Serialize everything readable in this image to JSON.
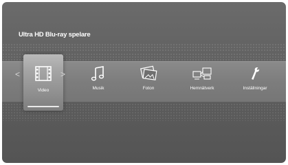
{
  "header": {
    "title": "Ultra HD Blu-ray spelare"
  },
  "menu": {
    "prev_arrow": "<",
    "next_arrow": ">",
    "items": [
      {
        "label": "Video",
        "icon": "film-icon",
        "selected": true
      },
      {
        "label": "Musik",
        "icon": "music-note-icon",
        "selected": false
      },
      {
        "label": "Foton",
        "icon": "photos-icon",
        "selected": false
      },
      {
        "label": "Hemnätverk",
        "icon": "home-network-icon",
        "selected": false
      },
      {
        "label": "Inställningar",
        "icon": "wrench-icon",
        "selected": false
      }
    ]
  },
  "colors": {
    "background": "#606060",
    "bar": "#7f7f7f",
    "text": "#ffffff"
  }
}
